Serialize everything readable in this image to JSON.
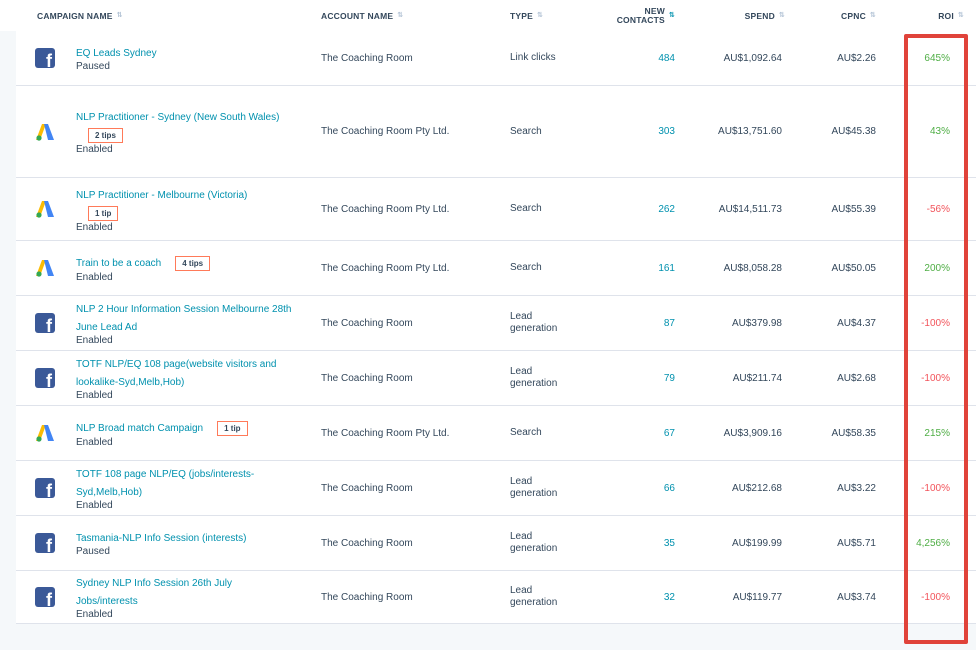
{
  "headers": {
    "campaign": "CAMPAIGN NAME",
    "account": "ACCOUNT NAME",
    "type": "TYPE",
    "contacts_line1": "NEW",
    "contacts_line2": "CONTACTS",
    "spend": "SPEND",
    "cpnc": "CPNC",
    "roi": "ROI"
  },
  "rows": [
    {
      "platform": "facebook",
      "name": "EQ Leads Sydney",
      "status": "Paused",
      "tips": "",
      "account": "The Coaching Room",
      "type": [
        "Link clicks"
      ],
      "contacts": "484",
      "spend": "AU$1,092.64",
      "cpnc": "AU$2.26",
      "roi": "645%",
      "roi_sign": "pos"
    },
    {
      "platform": "google-ads",
      "name": "NLP Practitioner - Sydney (New South Wales)",
      "status": "Enabled",
      "tips": "2 tips",
      "tip_inline": false,
      "account": "The Coaching Room Pty Ltd.",
      "type": [
        "Search"
      ],
      "contacts": "303",
      "spend": "AU$13,751.60",
      "cpnc": "AU$45.38",
      "roi": "43%",
      "roi_sign": "pos"
    },
    {
      "platform": "google-ads",
      "name": "NLP Practitioner - Melbourne (Victoria)",
      "status": "Enabled",
      "tips": "1 tip",
      "tip_inline": false,
      "account": "The Coaching Room Pty Ltd.",
      "type": [
        "Search"
      ],
      "contacts": "262",
      "spend": "AU$14,511.73",
      "cpnc": "AU$55.39",
      "roi": "-56%",
      "roi_sign": "neg"
    },
    {
      "platform": "google-ads",
      "name": "Train to be a coach",
      "status": "Enabled",
      "tips": "4 tips",
      "tip_inline": true,
      "account": "The Coaching Room Pty Ltd.",
      "type": [
        "Search"
      ],
      "contacts": "161",
      "spend": "AU$8,058.28",
      "cpnc": "AU$50.05",
      "roi": "200%",
      "roi_sign": "pos"
    },
    {
      "platform": "facebook",
      "name": "NLP 2 Hour Information Session Melbourne 28th June Lead Ad",
      "status": "Enabled",
      "tips": "",
      "account": "The Coaching Room",
      "type": [
        "Lead",
        "generation"
      ],
      "contacts": "87",
      "spend": "AU$379.98",
      "cpnc": "AU$4.37",
      "roi": "-100%",
      "roi_sign": "neg"
    },
    {
      "platform": "facebook",
      "name": "TOTF NLP/EQ 108 page(website visitors and lookalike-Syd,Melb,Hob)",
      "status": "Enabled",
      "tips": "",
      "account": "The Coaching Room",
      "type": [
        "Lead",
        "generation"
      ],
      "contacts": "79",
      "spend": "AU$211.74",
      "cpnc": "AU$2.68",
      "roi": "-100%",
      "roi_sign": "neg"
    },
    {
      "platform": "google-ads",
      "name": "NLP Broad match Campaign",
      "status": "Enabled",
      "tips": "1 tip",
      "tip_inline": true,
      "account": "The Coaching Room Pty Ltd.",
      "type": [
        "Search"
      ],
      "contacts": "67",
      "spend": "AU$3,909.16",
      "cpnc": "AU$58.35",
      "roi": "215%",
      "roi_sign": "pos"
    },
    {
      "platform": "facebook",
      "name": "TOTF 108 page NLP/EQ (jobs/interests-Syd,Melb,Hob)",
      "status": "Enabled",
      "tips": "",
      "account": "The Coaching Room",
      "type": [
        "Lead",
        "generation"
      ],
      "contacts": "66",
      "spend": "AU$212.68",
      "cpnc": "AU$3.22",
      "roi": "-100%",
      "roi_sign": "neg"
    },
    {
      "platform": "facebook",
      "name": "Tasmania-NLP Info Session (interests)",
      "status": "Paused",
      "tips": "",
      "account": "The Coaching Room",
      "type": [
        "Lead",
        "generation"
      ],
      "contacts": "35",
      "spend": "AU$199.99",
      "cpnc": "AU$5.71",
      "roi": "4,256%",
      "roi_sign": "pos"
    },
    {
      "platform": "facebook",
      "name": "Sydney NLP Info Session 26th July Jobs/interests",
      "status": "Enabled",
      "tips": "",
      "account": "The Coaching Room",
      "type": [
        "Lead",
        "generation"
      ],
      "contacts": "32",
      "spend": "AU$119.77",
      "cpnc": "AU$3.74",
      "roi": "-100%",
      "roi_sign": "neg"
    }
  ],
  "colors": {
    "link": "#0091ae",
    "positive": "#4fae45",
    "negative": "#f2545b",
    "highlight": "#e0433a",
    "tip_border": "#ff7a59",
    "facebook": "#3b5998"
  }
}
